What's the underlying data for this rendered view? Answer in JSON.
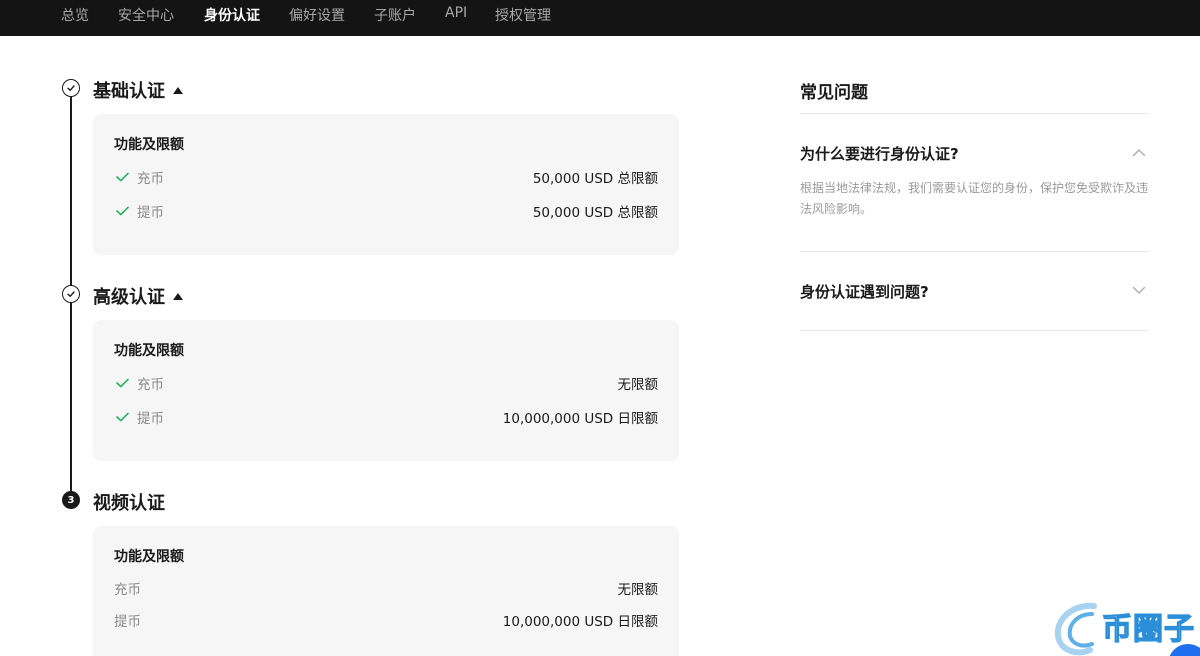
{
  "nav": {
    "items": [
      "总览",
      "安全中心",
      "身份认证",
      "偏好设置",
      "子账户",
      "API",
      "授权管理"
    ],
    "active_index": 2
  },
  "steps": [
    {
      "marker": "check",
      "title": "基础认证",
      "card": {
        "heading": "功能及限额",
        "rows": [
          {
            "label": "充币",
            "value": "50,000 USD 总限额",
            "checked": true
          },
          {
            "label": "提币",
            "value": "50,000 USD 总限额",
            "checked": true
          }
        ]
      }
    },
    {
      "marker": "check",
      "title": "高级认证",
      "card": {
        "heading": "功能及限额",
        "rows": [
          {
            "label": "充币",
            "value": "无限额",
            "checked": true
          },
          {
            "label": "提币",
            "value": "10,000,000 USD 日限额",
            "checked": true
          }
        ]
      }
    },
    {
      "marker": "3",
      "title": "视频认证",
      "card": {
        "heading": "功能及限额",
        "rows": [
          {
            "label": "充币",
            "value": "无限额",
            "checked": false
          },
          {
            "label": "提币",
            "value": "10,000,000 USD 日限额",
            "checked": false
          }
        ]
      }
    }
  ],
  "faq": {
    "title": "常见问题",
    "items": [
      {
        "question": "为什么要进行身份认证?",
        "expanded": true,
        "answer": "根据当地法律法规，我们需要认证您的身份，保护您免受欺诈及违法风险影响。"
      },
      {
        "question": "身份认证遇到问题?",
        "expanded": false
      }
    ]
  },
  "watermark": {
    "text": "币圈子"
  },
  "colors": {
    "nav_bg": "#141414",
    "check_green": "#22b35e",
    "card_bg": "#f6f6f6",
    "accent_blue": "#1e6ef0"
  },
  "icons": {
    "step_done": "check-circle-icon",
    "row_check": "check-icon",
    "expand_up": "chevron-up-icon",
    "expand_down": "chevron-down-icon"
  }
}
